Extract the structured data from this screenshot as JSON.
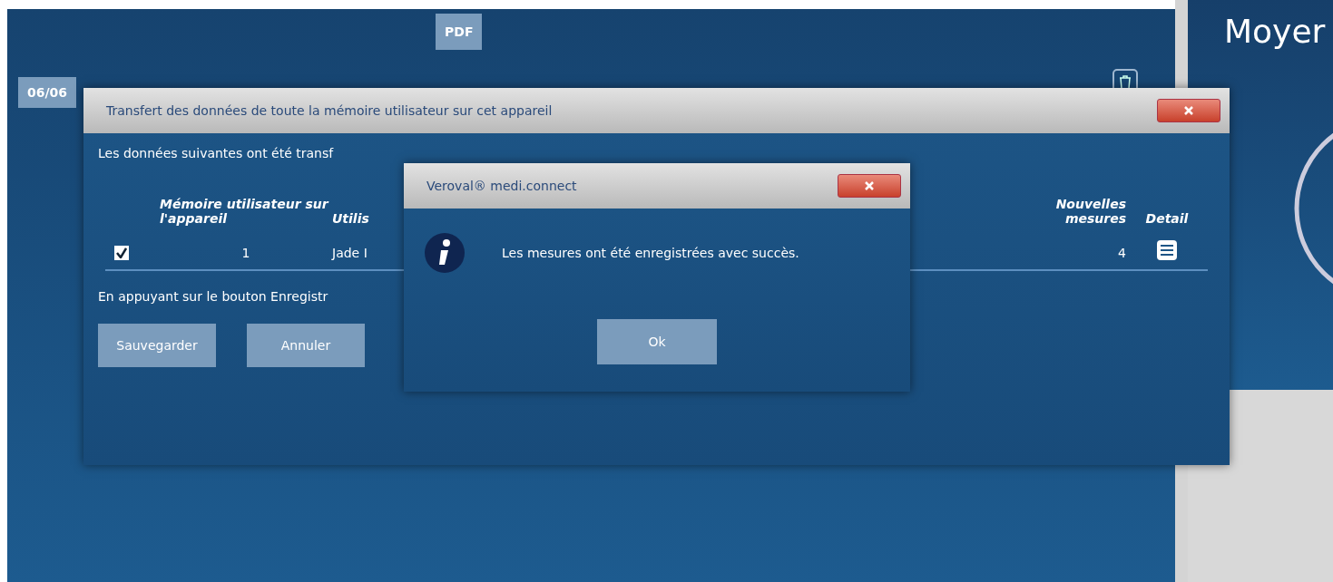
{
  "background": {
    "pdf_button": "PDF",
    "date_button": "06/06",
    "side_title": "Moyer"
  },
  "transfer_dialog": {
    "title": "Transfert des données de toute la mémoire utilisateur sur cet appareil",
    "intro": "Les données suivantes ont été transf",
    "columns": [
      {
        "label": "Mémoire utilisateur sur l'appareil"
      },
      {
        "label": "Utilis"
      },
      {
        "label": "Nouvelles mesures"
      },
      {
        "label": "Detail"
      }
    ],
    "rows": [
      {
        "checked": true,
        "memory": "1",
        "user": "Jade I",
        "new_measures": "4"
      }
    ],
    "note": "En appuyant sur le bouton Enregistr",
    "buttons": [
      "Sauvegarder",
      "Annuler"
    ]
  },
  "message_dialog": {
    "title": "Veroval® medi.connect",
    "message": "Les mesures ont été enregistrées avec succès.",
    "button": "Ok"
  }
}
